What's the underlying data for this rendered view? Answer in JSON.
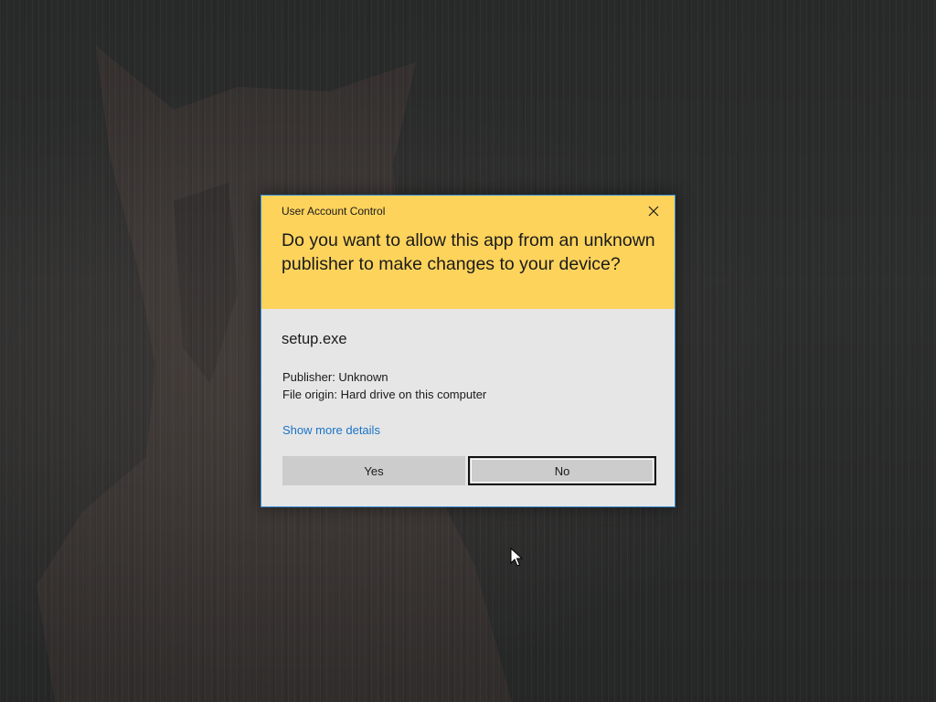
{
  "dialog": {
    "caption": "User Account Control",
    "question": "Do you want to allow this app from an unknown publisher to make changes to your device?",
    "app_name": "setup.exe",
    "publisher": "Publisher: Unknown",
    "file_origin": "File origin: Hard drive on this computer",
    "details_link": "Show more details",
    "yes_label": "Yes",
    "no_label": "No",
    "close_icon": "close-icon"
  },
  "colors": {
    "header_background": "#fdd35c",
    "body_background": "#e6e6e6",
    "button_background": "#cccccc",
    "link": "#1a73c8",
    "dialog_border": "#3a8fd8"
  },
  "wallpaper": {
    "subject": "cat-silhouette",
    "style": "dark rainy"
  }
}
